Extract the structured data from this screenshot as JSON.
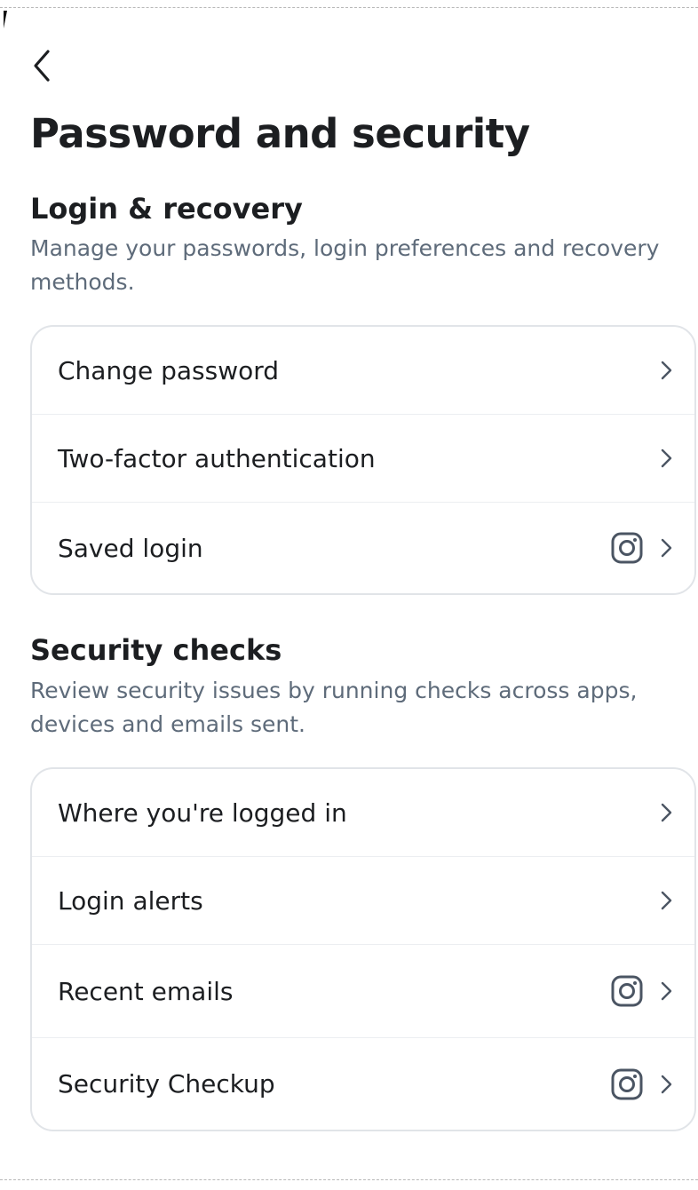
{
  "header": {
    "back_icon": "chevron-left-icon",
    "title": "Password and security"
  },
  "sections": [
    {
      "title": "Login & recovery",
      "description": "Manage your passwords, login preferences and recovery methods.",
      "items": [
        {
          "label": "Change password",
          "icons": [
            "chevron-right-icon"
          ]
        },
        {
          "label": "Two-factor authentication",
          "icons": [
            "chevron-right-icon"
          ]
        },
        {
          "label": "Saved login",
          "icons": [
            "instagram-icon",
            "chevron-right-icon"
          ]
        }
      ]
    },
    {
      "title": "Security checks",
      "description": "Review security issues by running checks across apps, devices and emails sent.",
      "items": [
        {
          "label": "Where you're logged in",
          "icons": [
            "chevron-right-icon"
          ]
        },
        {
          "label": "Login alerts",
          "icons": [
            "chevron-right-icon"
          ]
        },
        {
          "label": "Recent emails",
          "icons": [
            "instagram-icon",
            "chevron-right-icon"
          ]
        },
        {
          "label": "Security Checkup",
          "icons": [
            "instagram-icon",
            "chevron-right-icon"
          ]
        }
      ]
    }
  ],
  "colors": {
    "text_primary": "#1c1e21",
    "text_secondary": "#5e6b7a",
    "card_border": "#e1e4e8",
    "icon": "#4b5563"
  }
}
